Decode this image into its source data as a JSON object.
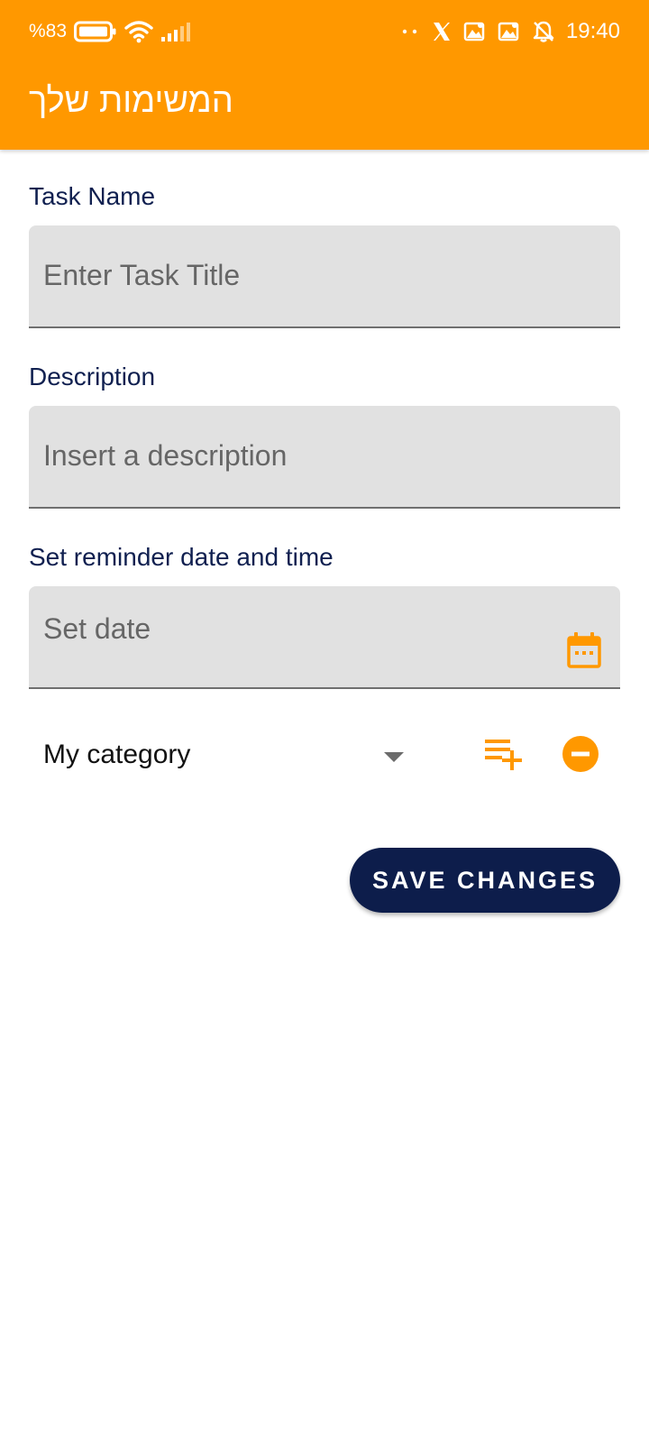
{
  "status_bar": {
    "battery": "%83",
    "time": "19:40",
    "left_icons": [
      "battery-icon",
      "wifi-icon",
      "signal-icon"
    ],
    "right_icons": [
      "dots-icon",
      "x-app-icon",
      "gallery-notification-icon",
      "gallery-notification-icon",
      "muted-bell-icon"
    ]
  },
  "app_bar": {
    "title": "המשימות שלך"
  },
  "form": {
    "task_name": {
      "label": "Task Name",
      "value": "",
      "placeholder": "Enter Task Title"
    },
    "description": {
      "label": "Description",
      "value": "",
      "placeholder": "Insert a description"
    },
    "reminder": {
      "label": "Set reminder date and time",
      "value": "",
      "placeholder": "Set date",
      "icon": "calendar-icon"
    },
    "category": {
      "selected": "My category",
      "add_icon": "playlist-add-icon",
      "remove_icon": "remove-circle-icon"
    },
    "save_label": "SAVE CHANGES"
  },
  "colors": {
    "primary": "#FF9800",
    "navy": "#0D1D4B",
    "label_text": "#102050",
    "field_bg": "#E1E1E1"
  }
}
